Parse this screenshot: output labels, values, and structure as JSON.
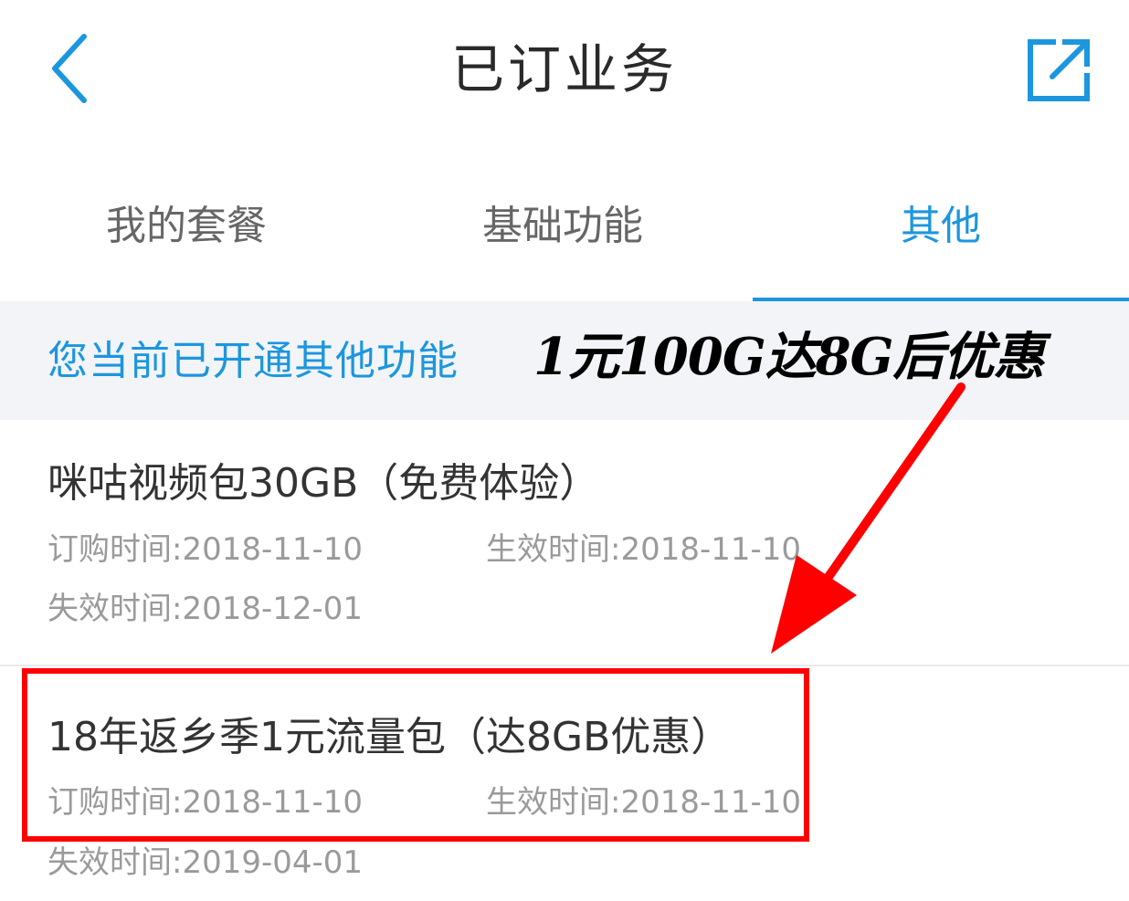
{
  "header": {
    "title": "已订业务"
  },
  "tabs": [
    {
      "label": "我的套餐",
      "active": false
    },
    {
      "label": "基础功能",
      "active": false
    },
    {
      "label": "其他",
      "active": true
    }
  ],
  "section": {
    "title": "您当前已开通其他功能"
  },
  "annotation": {
    "text": "1元100G达8G后优惠"
  },
  "items": [
    {
      "name": "咪咕视频包30GB（免费体验）",
      "order_time": "订购时间:2018-11-10",
      "effective_time": "生效时间:2018-11-10",
      "expire_time": "失效时间:2018-12-01"
    },
    {
      "name": "18年返乡季1元流量包（达8GB优惠）",
      "order_time": "订购时间:2018-11-10",
      "effective_time": "生效时间:2018-11-10",
      "expire_time": "失效时间:2019-04-01"
    }
  ],
  "colors": {
    "accent": "#1c96df",
    "annotation_red": "#ff0000",
    "banner_bg": "#f2f4f7"
  },
  "icons": {
    "back": "chevron-left-icon",
    "share": "share-icon"
  }
}
